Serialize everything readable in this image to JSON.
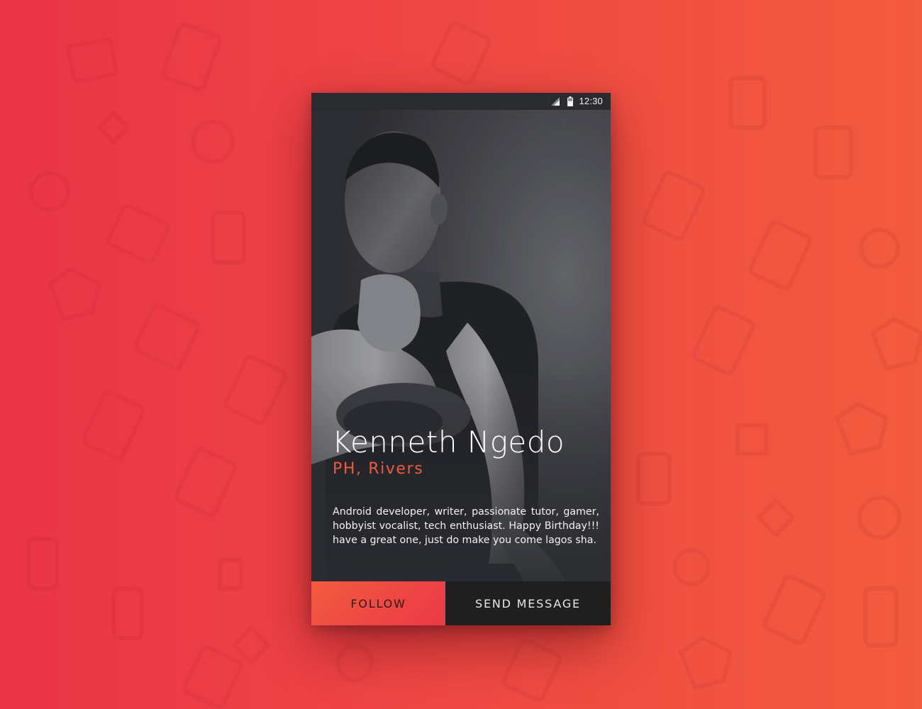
{
  "status_bar": {
    "time": "12:30",
    "icons": [
      "signal-icon",
      "battery-icon"
    ]
  },
  "profile": {
    "name": "Kenneth Ngedo",
    "location": "PH, Rivers",
    "bio": "Android developer, writer, passionate tutor, gamer, hobbyist vocalist, tech enthusiast. Happy Birthday!!! have a great one, just do make you come lagos sha."
  },
  "actions": {
    "follow_label": "FOLLOW",
    "message_label": "SEND MESSAGE"
  },
  "colors": {
    "accent": "#f15a3f",
    "background_start": "#ea3447",
    "background_end": "#f35b3d",
    "button_dark": "#1f1f1f"
  }
}
